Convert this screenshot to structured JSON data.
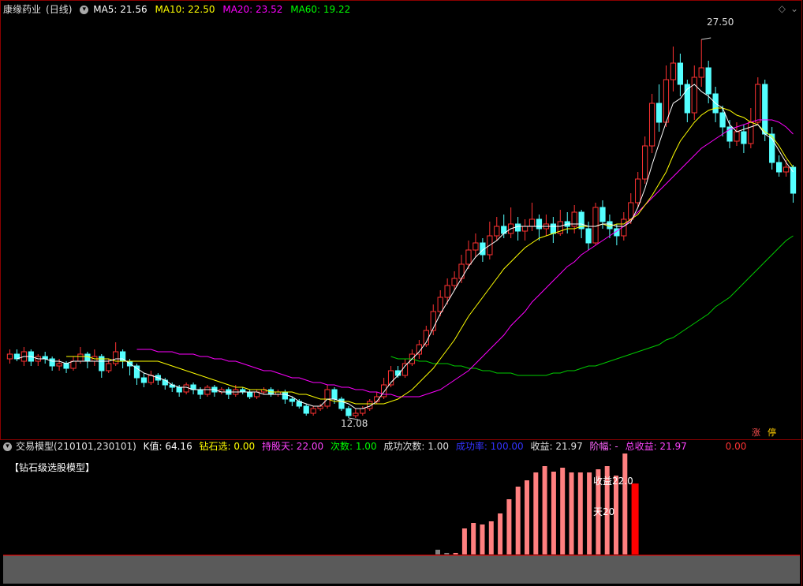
{
  "header": {
    "stock_name": "康缘药业",
    "period": "(日线)",
    "ma5": "MA5: 21.56",
    "ma10": "MA10: 22.50",
    "ma20": "MA20: 23.52",
    "ma60": "MA60: 19.22"
  },
  "indicator_header": {
    "name": "交易模型(210101,230101)",
    "k_value": "K值: 64.16",
    "diamond_select": "钻石选: 0.00",
    "hold_days": "持股天: 22.00",
    "count": "次数: 1.00",
    "success_count": "成功次数: 1.00",
    "success_rate": "成功率: 100.00",
    "profit": "收益: 21.97",
    "amplitude": "阶幅: -",
    "total_profit": "总收益: 21.97",
    "extra": "0.00"
  },
  "indicator_title": "【钻石级选股模型】",
  "annotations": {
    "profit_label": "收益22.0",
    "days_label": "天20",
    "high_label": "27.50",
    "low_label": "12.08"
  },
  "badges": {
    "rise": "涨",
    "stop": "停"
  },
  "colors": {
    "up": "#ff3232",
    "down": "#54ffff",
    "ma5": "#ffffff",
    "ma10": "#ffff00",
    "ma20": "#ff00ff",
    "ma60": "#00cc00",
    "bar_pink": "#ff8080",
    "bar_red": "#ff0000",
    "bar_gray": "#808080"
  },
  "chart_data": {
    "type": "candlestick",
    "price_range": [
      11.5,
      28.5
    ],
    "candles": [
      [
        14.0,
        14.2,
        14.4,
        13.8
      ],
      [
        14.2,
        14.0,
        14.4,
        13.9
      ],
      [
        13.9,
        14.3,
        14.5,
        13.7
      ],
      [
        14.3,
        13.9,
        14.4,
        13.7
      ],
      [
        13.9,
        14.1,
        14.2,
        13.7
      ],
      [
        14.1,
        14.0,
        14.3,
        13.8
      ],
      [
        14.0,
        13.7,
        14.1,
        13.5
      ],
      [
        13.7,
        13.8,
        14.0,
        13.5
      ],
      [
        13.8,
        13.6,
        13.9,
        13.4
      ],
      [
        13.6,
        13.9,
        14.1,
        13.5
      ],
      [
        13.9,
        14.2,
        14.5,
        13.8
      ],
      [
        14.2,
        13.9,
        14.3,
        13.6
      ],
      [
        13.9,
        14.1,
        14.4,
        13.7
      ],
      [
        14.1,
        13.5,
        14.2,
        13.2
      ],
      [
        13.5,
        13.8,
        14.0,
        13.4
      ],
      [
        13.8,
        14.3,
        14.7,
        13.7
      ],
      [
        14.3,
        13.9,
        14.4,
        13.6
      ],
      [
        13.9,
        13.7,
        14.0,
        13.3
      ],
      [
        13.7,
        13.2,
        13.8,
        12.9
      ],
      [
        13.2,
        13.0,
        13.4,
        12.8
      ],
      [
        13.0,
        13.3,
        13.5,
        12.9
      ],
      [
        13.3,
        13.1,
        13.4,
        12.9
      ],
      [
        13.1,
        12.9,
        13.2,
        12.7
      ],
      [
        12.9,
        12.8,
        13.0,
        12.6
      ],
      [
        12.8,
        12.6,
        12.9,
        12.4
      ],
      [
        12.6,
        12.9,
        13.0,
        12.5
      ],
      [
        12.9,
        12.7,
        13.0,
        12.5
      ],
      [
        12.7,
        12.5,
        12.8,
        12.3
      ],
      [
        12.5,
        12.8,
        12.9,
        12.4
      ],
      [
        12.8,
        12.6,
        12.9,
        12.4
      ],
      [
        12.6,
        12.7,
        12.8,
        12.5
      ],
      [
        12.7,
        12.5,
        12.8,
        12.3
      ],
      [
        12.5,
        12.7,
        12.9,
        12.4
      ],
      [
        12.7,
        12.6,
        12.8,
        12.5
      ],
      [
        12.6,
        12.4,
        12.7,
        12.3
      ],
      [
        12.4,
        12.6,
        12.7,
        12.3
      ],
      [
        12.6,
        12.7,
        12.8,
        12.5
      ],
      [
        12.7,
        12.5,
        12.8,
        12.4
      ],
      [
        12.5,
        12.6,
        12.7,
        12.4
      ],
      [
        12.6,
        12.3,
        12.7,
        12.1
      ],
      [
        12.3,
        12.2,
        12.4,
        12.0
      ],
      [
        12.2,
        12.0,
        12.3,
        11.9
      ],
      [
        12.0,
        11.7,
        12.1,
        11.6
      ],
      [
        11.7,
        11.9,
        12.0,
        11.6
      ],
      [
        11.9,
        12.0,
        12.1,
        11.8
      ],
      [
        12.0,
        12.7,
        12.9,
        11.9
      ],
      [
        12.7,
        12.3,
        12.8,
        12.1
      ],
      [
        12.3,
        11.9,
        12.4,
        11.8
      ],
      [
        11.9,
        11.6,
        12.0,
        11.5
      ],
      [
        11.6,
        11.7,
        11.9,
        11.5
      ],
      [
        11.7,
        11.9,
        12.0,
        11.6
      ],
      [
        11.9,
        12.2,
        12.3,
        11.8
      ],
      [
        12.2,
        12.4,
        12.6,
        12.1
      ],
      [
        12.4,
        12.9,
        13.2,
        12.3
      ],
      [
        12.9,
        13.5,
        13.7,
        12.8
      ],
      [
        13.5,
        13.3,
        13.7,
        13.2
      ],
      [
        13.3,
        13.8,
        14.0,
        13.2
      ],
      [
        13.8,
        14.2,
        14.4,
        13.7
      ],
      [
        14.2,
        14.6,
        14.8,
        14.0
      ],
      [
        14.6,
        15.2,
        15.4,
        14.5
      ],
      [
        15.2,
        16.0,
        16.3,
        15.0
      ],
      [
        16.0,
        16.6,
        16.9,
        15.8
      ],
      [
        16.6,
        17.1,
        17.4,
        16.3
      ],
      [
        17.1,
        17.4,
        17.7,
        16.9
      ],
      [
        17.4,
        18.0,
        18.4,
        17.2
      ],
      [
        18.0,
        18.6,
        19.0,
        17.8
      ],
      [
        18.6,
        18.9,
        19.3,
        18.3
      ],
      [
        18.9,
        18.4,
        19.1,
        18.1
      ],
      [
        18.4,
        19.2,
        19.8,
        18.2
      ],
      [
        19.2,
        19.6,
        20.0,
        19.0
      ],
      [
        19.6,
        19.3,
        20.1,
        19.1
      ],
      [
        19.3,
        19.7,
        20.4,
        19.1
      ],
      [
        19.7,
        19.4,
        20.0,
        19.0
      ],
      [
        19.4,
        19.6,
        19.9,
        19.0
      ],
      [
        19.6,
        19.9,
        20.6,
        19.4
      ],
      [
        19.9,
        19.5,
        20.1,
        19.0
      ],
      [
        19.5,
        19.7,
        20.1,
        19.2
      ],
      [
        19.7,
        19.3,
        20.0,
        18.9
      ],
      [
        19.3,
        19.8,
        20.3,
        19.2
      ],
      [
        19.8,
        19.6,
        20.2,
        19.3
      ],
      [
        19.6,
        20.2,
        20.5,
        19.3
      ],
      [
        20.2,
        19.5,
        20.3,
        19.1
      ],
      [
        19.5,
        18.9,
        19.8,
        18.6
      ],
      [
        18.9,
        20.4,
        20.6,
        18.8
      ],
      [
        20.4,
        19.8,
        20.7,
        19.5
      ],
      [
        19.8,
        19.5,
        20.1,
        19.1
      ],
      [
        19.5,
        19.2,
        19.7,
        18.8
      ],
      [
        19.2,
        19.9,
        20.2,
        19.0
      ],
      [
        19.9,
        20.6,
        21.0,
        19.7
      ],
      [
        20.6,
        21.6,
        21.9,
        20.4
      ],
      [
        21.6,
        23.0,
        23.4,
        21.4
      ],
      [
        23.0,
        24.8,
        25.2,
        22.7
      ],
      [
        24.8,
        24.0,
        25.6,
        23.6
      ],
      [
        24.0,
        25.8,
        26.4,
        23.8
      ],
      [
        25.8,
        26.5,
        27.2,
        25.3
      ],
      [
        26.5,
        25.6,
        26.9,
        25.1
      ],
      [
        25.6,
        24.4,
        25.8,
        24.0
      ],
      [
        24.4,
        25.9,
        26.4,
        24.1
      ],
      [
        25.9,
        26.3,
        27.5,
        25.5
      ],
      [
        26.3,
        25.2,
        26.6,
        24.8
      ],
      [
        25.2,
        24.4,
        25.5,
        24.0
      ],
      [
        24.4,
        23.8,
        24.7,
        23.4
      ],
      [
        23.8,
        23.2,
        24.1,
        22.9
      ],
      [
        23.2,
        23.6,
        24.0,
        23.0
      ],
      [
        23.6,
        23.1,
        23.9,
        22.7
      ],
      [
        23.1,
        24.0,
        24.6,
        22.9
      ],
      [
        24.0,
        25.6,
        25.9,
        23.9
      ],
      [
        25.6,
        23.5,
        25.8,
        23.2
      ],
      [
        23.5,
        22.3,
        23.8,
        22.0
      ],
      [
        22.3,
        21.9,
        22.6,
        21.7
      ],
      [
        21.9,
        22.1,
        22.4,
        21.7
      ],
      [
        22.1,
        21.0,
        22.2,
        20.6
      ]
    ],
    "ma5": [
      14.0,
      14.1,
      14.1,
      14.0,
      14.0,
      13.9,
      13.9,
      13.8,
      13.9,
      13.9,
      13.9,
      13.9,
      13.9,
      13.9,
      14.0,
      14.0,
      13.8,
      13.6,
      13.4,
      13.3,
      13.2,
      13.1,
      12.9,
      12.8,
      12.8,
      12.7,
      12.7,
      12.7,
      12.7,
      12.6,
      12.6,
      12.6,
      12.6,
      12.6,
      12.6,
      12.5,
      12.5,
      12.5,
      12.5,
      12.4,
      12.2,
      12.1,
      12.0,
      12.0,
      12.3,
      12.3,
      12.2,
      12.1,
      11.9,
      11.9,
      12.0,
      12.2,
      12.6,
      13.0,
      13.3,
      13.7,
      14.0,
      14.3,
      14.7,
      15.3,
      15.9,
      16.4,
      16.9,
      17.4,
      17.9,
      18.3,
      18.6,
      18.8,
      19.0,
      19.3,
      19.5,
      19.6,
      19.6,
      19.6,
      19.6,
      19.6,
      19.6,
      19.6,
      19.7,
      19.7,
      19.7,
      19.6,
      19.6,
      19.7,
      19.7,
      19.6,
      19.6,
      19.8,
      20.4,
      21.2,
      22.2,
      23.1,
      24.0,
      24.8,
      25.0,
      25.4,
      25.6,
      25.3,
      25.1,
      24.8,
      24.6,
      23.9,
      23.6,
      23.7,
      23.8,
      23.9,
      23.5,
      23.3,
      22.8,
      22.3,
      21.9
    ],
    "ma10": [
      14.1,
      14.1,
      14.1,
      14.1,
      14.0,
      14.0,
      14.0,
      13.9,
      13.9,
      13.9,
      13.9,
      13.9,
      13.9,
      13.9,
      13.8,
      13.7,
      13.6,
      13.5,
      13.4,
      13.3,
      13.2,
      13.1,
      13.0,
      12.9,
      12.8,
      12.8,
      12.7,
      12.7,
      12.7,
      12.6,
      12.6,
      12.6,
      12.6,
      12.5,
      12.5,
      12.4,
      12.3,
      12.3,
      12.2,
      12.2,
      12.2,
      12.1,
      12.1,
      12.1,
      12.1,
      12.1,
      12.2,
      12.3,
      12.5,
      12.7,
      13.0,
      13.3,
      13.6,
      14.0,
      14.4,
      14.8,
      15.3,
      15.8,
      16.2,
      16.6,
      17.0,
      17.4,
      17.8,
      18.1,
      18.4,
      18.7,
      18.9,
      19.1,
      19.2,
      19.3,
      19.4,
      19.5,
      19.5,
      19.6,
      19.6,
      19.6,
      19.7,
      19.6,
      19.7,
      19.7,
      19.9,
      20.1,
      20.5,
      20.9,
      21.4,
      21.9,
      22.6,
      23.2,
      23.6,
      24.0,
      24.3,
      24.5,
      24.6,
      24.6,
      24.5,
      24.3,
      24.2,
      24.0,
      23.9,
      23.6,
      23.4,
      23.0,
      22.5,
      22.1
    ],
    "ma20": [
      14.4,
      14.4,
      14.4,
      14.3,
      14.3,
      14.3,
      14.2,
      14.2,
      14.2,
      14.1,
      14.1,
      14.0,
      14.0,
      13.9,
      13.9,
      13.8,
      13.7,
      13.6,
      13.5,
      13.5,
      13.4,
      13.3,
      13.2,
      13.2,
      13.1,
      13.0,
      13.0,
      12.9,
      12.9,
      12.8,
      12.8,
      12.7,
      12.7,
      12.6,
      12.6,
      12.5,
      12.5,
      12.4,
      12.4,
      12.4,
      12.4,
      12.5,
      12.6,
      12.7,
      12.9,
      13.1,
      13.3,
      13.5,
      13.8,
      14.1,
      14.4,
      14.7,
      15.0,
      15.4,
      15.7,
      16.0,
      16.4,
      16.7,
      17.0,
      17.3,
      17.6,
      17.9,
      18.1,
      18.4,
      18.6,
      18.8,
      19.0,
      19.2,
      19.4,
      19.6,
      19.9,
      20.2,
      20.5,
      20.8,
      21.1,
      21.4,
      21.7,
      22.0,
      22.3,
      22.6,
      22.9,
      23.1,
      23.3,
      23.5,
      23.7,
      23.8,
      23.9,
      24.0,
      24.1,
      24.1,
      24.1,
      24.0,
      23.8,
      23.5
    ],
    "ma60": [
      14.1,
      14.0,
      14.0,
      14.0,
      13.9,
      13.9,
      13.8,
      13.8,
      13.8,
      13.7,
      13.7,
      13.6,
      13.6,
      13.5,
      13.5,
      13.4,
      13.4,
      13.4,
      13.3,
      13.3,
      13.3,
      13.3,
      13.3,
      13.4,
      13.4,
      13.5,
      13.5,
      13.6,
      13.7,
      13.7,
      13.8,
      13.9,
      14.0,
      14.1,
      14.2,
      14.3,
      14.4,
      14.5,
      14.6,
      14.8,
      14.9,
      15.1,
      15.3,
      15.5,
      15.7,
      15.9,
      16.2,
      16.4,
      16.6,
      16.9,
      17.2,
      17.5,
      17.8,
      18.1,
      18.4,
      18.7,
      19.0,
      19.2
    ],
    "indicator_bars": {
      "gray": [
        6,
        2
      ],
      "pink": [
        2,
        33,
        40,
        38,
        42,
        52,
        70,
        86,
        94,
        104,
        112,
        105,
        110,
        104,
        104,
        104,
        108,
        112,
        100,
        128
      ],
      "red": 90
    }
  }
}
